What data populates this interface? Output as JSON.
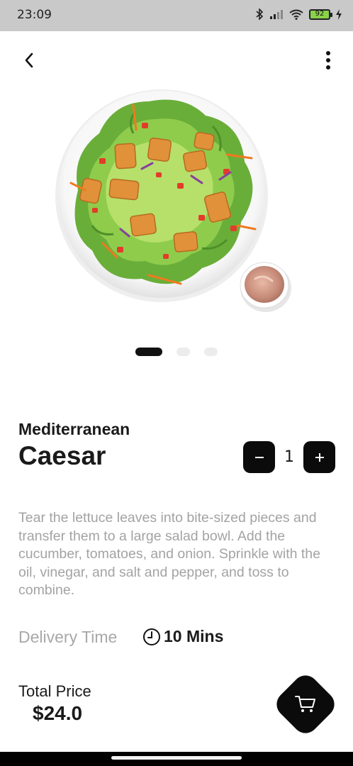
{
  "status_bar": {
    "time": "23:09",
    "battery_level": "92",
    "icons": [
      "bluetooth-icon",
      "signal-icon",
      "wifi-icon",
      "battery-icon",
      "charging-icon"
    ]
  },
  "nav": {
    "back_icon": "chevron-left-icon",
    "more_icon": "more-vertical-icon"
  },
  "carousel": {
    "image": "caesar-salad-photo",
    "page_count": 3,
    "active_index": 0
  },
  "product": {
    "subtitle": "Mediterranean",
    "title": "Caesar",
    "quantity": "1",
    "description": "Tear the lettuce leaves into bite-sized pieces and transfer them to a large salad bowl. Add the cucumber, tomatoes, and onion. Sprinkle with the oil, vinegar, and salt and pepper, and toss to combine."
  },
  "delivery": {
    "label": "Delivery Time",
    "value": "10 Mins"
  },
  "price": {
    "label": "Total Price",
    "value": "$24.0"
  },
  "colors": {
    "accent": "#0b0b0b",
    "muted_text": "#a3a3a3",
    "status_bar": "#c9c9c9",
    "battery": "#8ad14a"
  }
}
